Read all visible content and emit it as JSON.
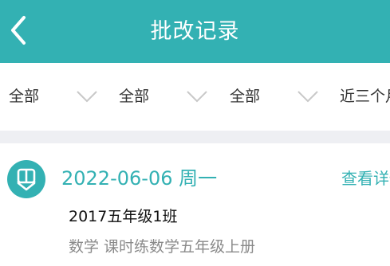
{
  "header": {
    "title": "批改记录",
    "back_icon": "chevron-left-icon"
  },
  "filters": [
    {
      "label": "全部",
      "icon": "chevron-down-icon"
    },
    {
      "label": "全部",
      "icon": "chevron-down-icon"
    },
    {
      "label": "全部",
      "icon": "chevron-down-icon"
    },
    {
      "label": "近三个月"
    }
  ],
  "records": [
    {
      "date": "2022-06-06 周一",
      "class_name": "2017五年级1班",
      "subject": "数学 课时练数学五年级上册",
      "link_label": "查看详情",
      "icon": "pencil-badge-icon"
    }
  ],
  "colors": {
    "accent": "#33b1b3",
    "divider": "#eeeff3",
    "chevron": "#c8c8c8",
    "muted_text": "#8a8a8a"
  }
}
